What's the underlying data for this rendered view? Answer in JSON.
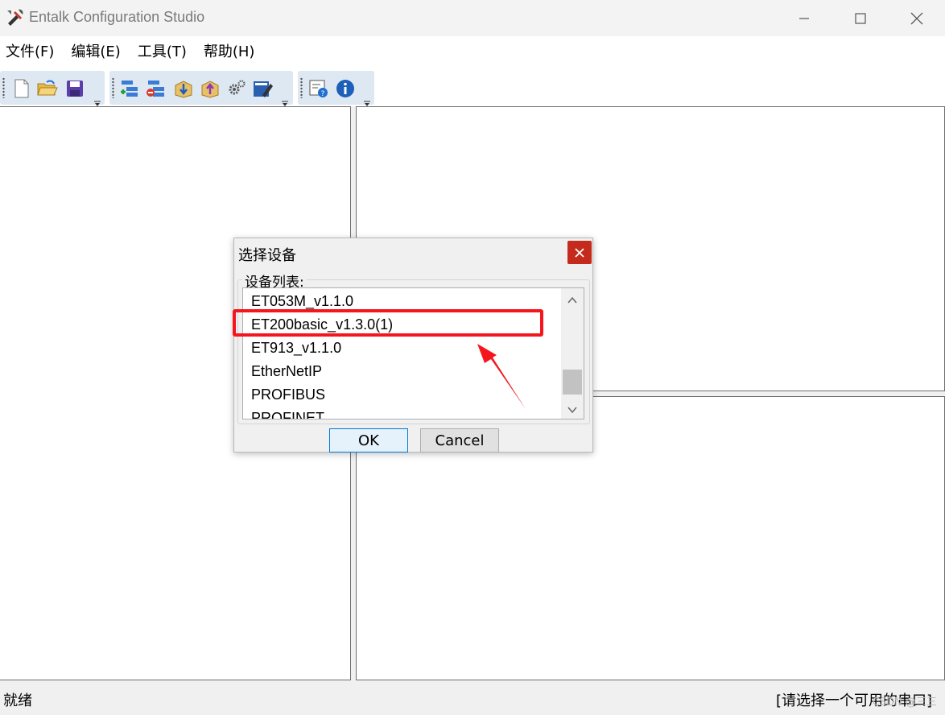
{
  "window": {
    "title": "Entalk Configuration Studio"
  },
  "menu": {
    "items": [
      {
        "label": "文件(F)"
      },
      {
        "label": "编辑(E)"
      },
      {
        "label": "工具(T)"
      },
      {
        "label": "帮助(H)"
      }
    ]
  },
  "toolbar": {
    "groups": [
      {
        "icons": [
          "new-file-icon",
          "open-folder-icon",
          "save-icon"
        ]
      },
      {
        "icons": [
          "add-node-icon",
          "remove-node-icon",
          "download-icon",
          "upload-icon",
          "settings-gear-icon",
          "edit-icon"
        ]
      },
      {
        "icons": [
          "help-icon",
          "info-icon"
        ]
      }
    ]
  },
  "dialog": {
    "title": "选择设备",
    "group_label": "设备列表:",
    "items": [
      {
        "label": "ET053M_v1.1.0"
      },
      {
        "label": "ET200basic_v1.3.0(1)"
      },
      {
        "label": "ET913_v1.1.0"
      },
      {
        "label": "EtherNetIP"
      },
      {
        "label": "PROFIBUS"
      },
      {
        "label": "PROFINET"
      }
    ],
    "highlighted_item": "ET200basic_v1.3.0(1)",
    "ok_label": "OK",
    "cancel_label": "Cancel"
  },
  "status": {
    "left": "就绪",
    "right": "[请选择一个可用的串口]"
  },
  "watermark": "CSDN @三三"
}
